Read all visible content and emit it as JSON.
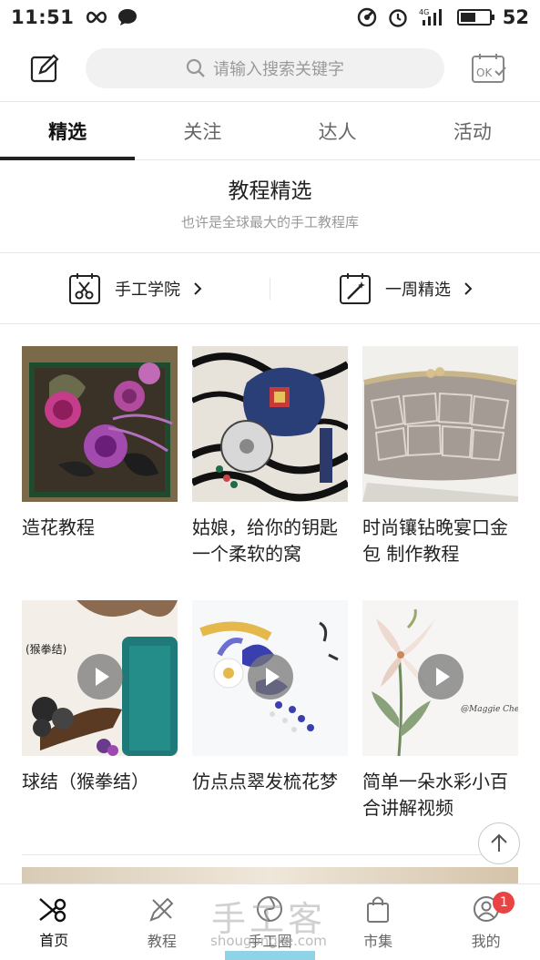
{
  "status": {
    "time": "11:51",
    "battery_text": "52",
    "battery_level": 0.52,
    "network": "4G"
  },
  "search": {
    "placeholder": "请输入搜索关键字"
  },
  "tabs": [
    {
      "label": "精选",
      "active": true
    },
    {
      "label": "关注",
      "active": false
    },
    {
      "label": "达人",
      "active": false
    },
    {
      "label": "活动",
      "active": false
    }
  ],
  "section": {
    "title": "教程精选",
    "subtitle": "也许是全球最大的手工教程库"
  },
  "quick_links": [
    {
      "label": "手工学院",
      "icon": "scissors-board-icon"
    },
    {
      "label": "一周精选",
      "icon": "calendar-wand-icon"
    }
  ],
  "cards": [
    {
      "title": "造花教程",
      "video": false
    },
    {
      "title": "姑娘，给你的钥匙一个柔软的窝",
      "video": false
    },
    {
      "title": "时尚镶钻晚宴口金包 制作教程",
      "video": false
    },
    {
      "title": "球结（猴拳结）",
      "video": true
    },
    {
      "title": "仿点点翠发梳花梦",
      "video": true
    },
    {
      "title": "简单一朵水彩小百合讲解视频",
      "video": true
    }
  ],
  "image_text": {
    "card4_tag": "(猴拳结)"
  },
  "nav": [
    {
      "label": "首页",
      "active": true
    },
    {
      "label": "教程",
      "active": false
    },
    {
      "label": "手工圈",
      "active": false
    },
    {
      "label": "市集",
      "active": false
    },
    {
      "label": "我的",
      "active": false,
      "badge": "1"
    }
  ],
  "watermark": {
    "text": "手工客",
    "url": "shougongke.com"
  },
  "colors": {
    "accent": "#222222",
    "badge": "#e94343",
    "muted": "#999999"
  }
}
